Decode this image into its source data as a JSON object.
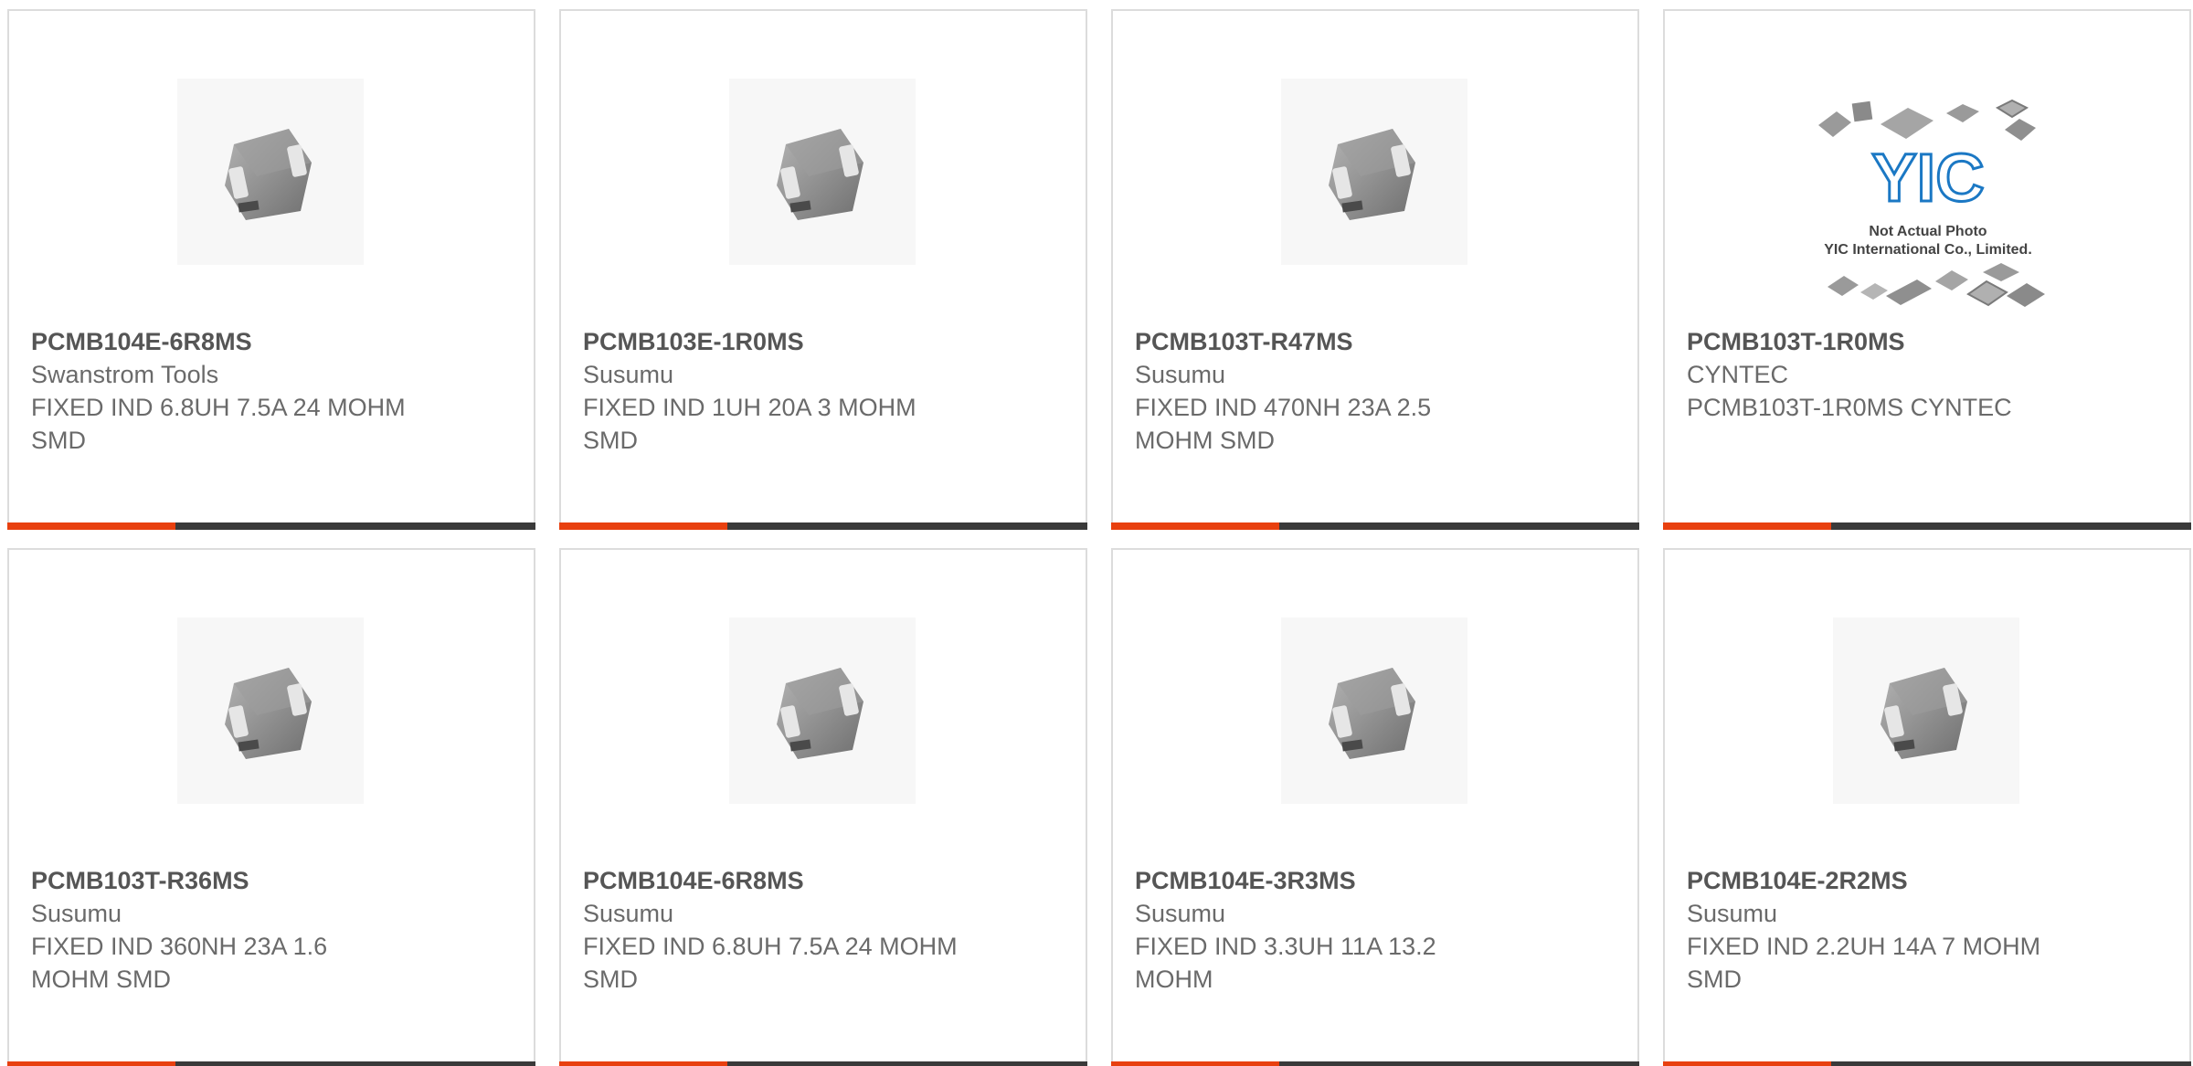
{
  "colors": {
    "accent": "#e8400f",
    "bar": "#3a3a3a",
    "border": "#dcdcdc",
    "text": "#6a6a6a"
  },
  "products": [
    {
      "part_number": "PCMB104E-6R8MS",
      "manufacturer": "Swanstrom Tools",
      "description": "FIXED IND 6.8UH 7.5A 24 MOHM SMD",
      "image": "inductor-icon"
    },
    {
      "part_number": "PCMB103E-1R0MS",
      "manufacturer": "Susumu",
      "description": "FIXED IND 1UH 20A 3 MOHM SMD",
      "image": "inductor-icon"
    },
    {
      "part_number": "PCMB103T-R47MS",
      "manufacturer": "Susumu",
      "description": "FIXED IND 470NH 23A 2.5 MOHM SMD",
      "image": "inductor-icon"
    },
    {
      "part_number": "PCMB103T-1R0MS",
      "manufacturer": "CYNTEC",
      "description": "PCMB103T-1R0MS CYNTEC",
      "image": "yic-placeholder-icon",
      "image_caption_1": "Not Actual Photo",
      "image_caption_2": "YIC International Co., Limited.",
      "image_logo": "YIC"
    },
    {
      "part_number": "PCMB103T-R36MS",
      "manufacturer": "Susumu",
      "description": "FIXED IND 360NH 23A 1.6 MOHM SMD",
      "image": "inductor-icon"
    },
    {
      "part_number": "PCMB104E-6R8MS",
      "manufacturer": "Susumu",
      "description": "FIXED IND 6.8UH 7.5A 24 MOHM SMD",
      "image": "inductor-icon"
    },
    {
      "part_number": "PCMB104E-3R3MS",
      "manufacturer": "Susumu",
      "description": "FIXED IND 3.3UH 11A 13.2 MOHM",
      "image": "inductor-icon"
    },
    {
      "part_number": "PCMB104E-2R2MS",
      "manufacturer": "Susumu",
      "description": "FIXED IND 2.2UH 14A 7 MOHM SMD",
      "image": "inductor-icon"
    }
  ]
}
